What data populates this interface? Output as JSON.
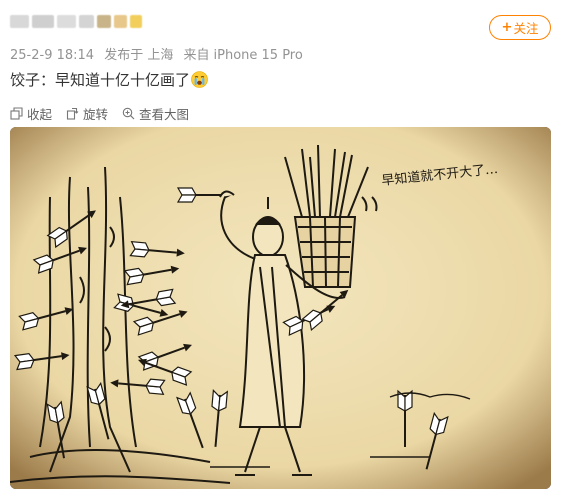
{
  "header": {
    "follow_label": "关注",
    "follow_plus": "+"
  },
  "meta": {
    "time": "25-2-9 18:14",
    "published_in": "发布于 上海",
    "device_prefix": "来自",
    "device": "iPhone 15 Pro"
  },
  "post": {
    "text": "饺子：早知道十亿十亿画了",
    "emoji": "crying-face"
  },
  "toolbar": {
    "collapse_label": "收起",
    "rotate_label": "旋转",
    "view_large_label": "查看大图"
  },
  "image": {
    "caption": "早知道就不开大了…",
    "description_icon": "cartoon-arrows-sketch"
  },
  "colors": {
    "accent": "#ff8200",
    "meta_text": "#939393",
    "body_text": "#333333",
    "paper": "#efe0b4",
    "ink": "#1e1a12"
  }
}
